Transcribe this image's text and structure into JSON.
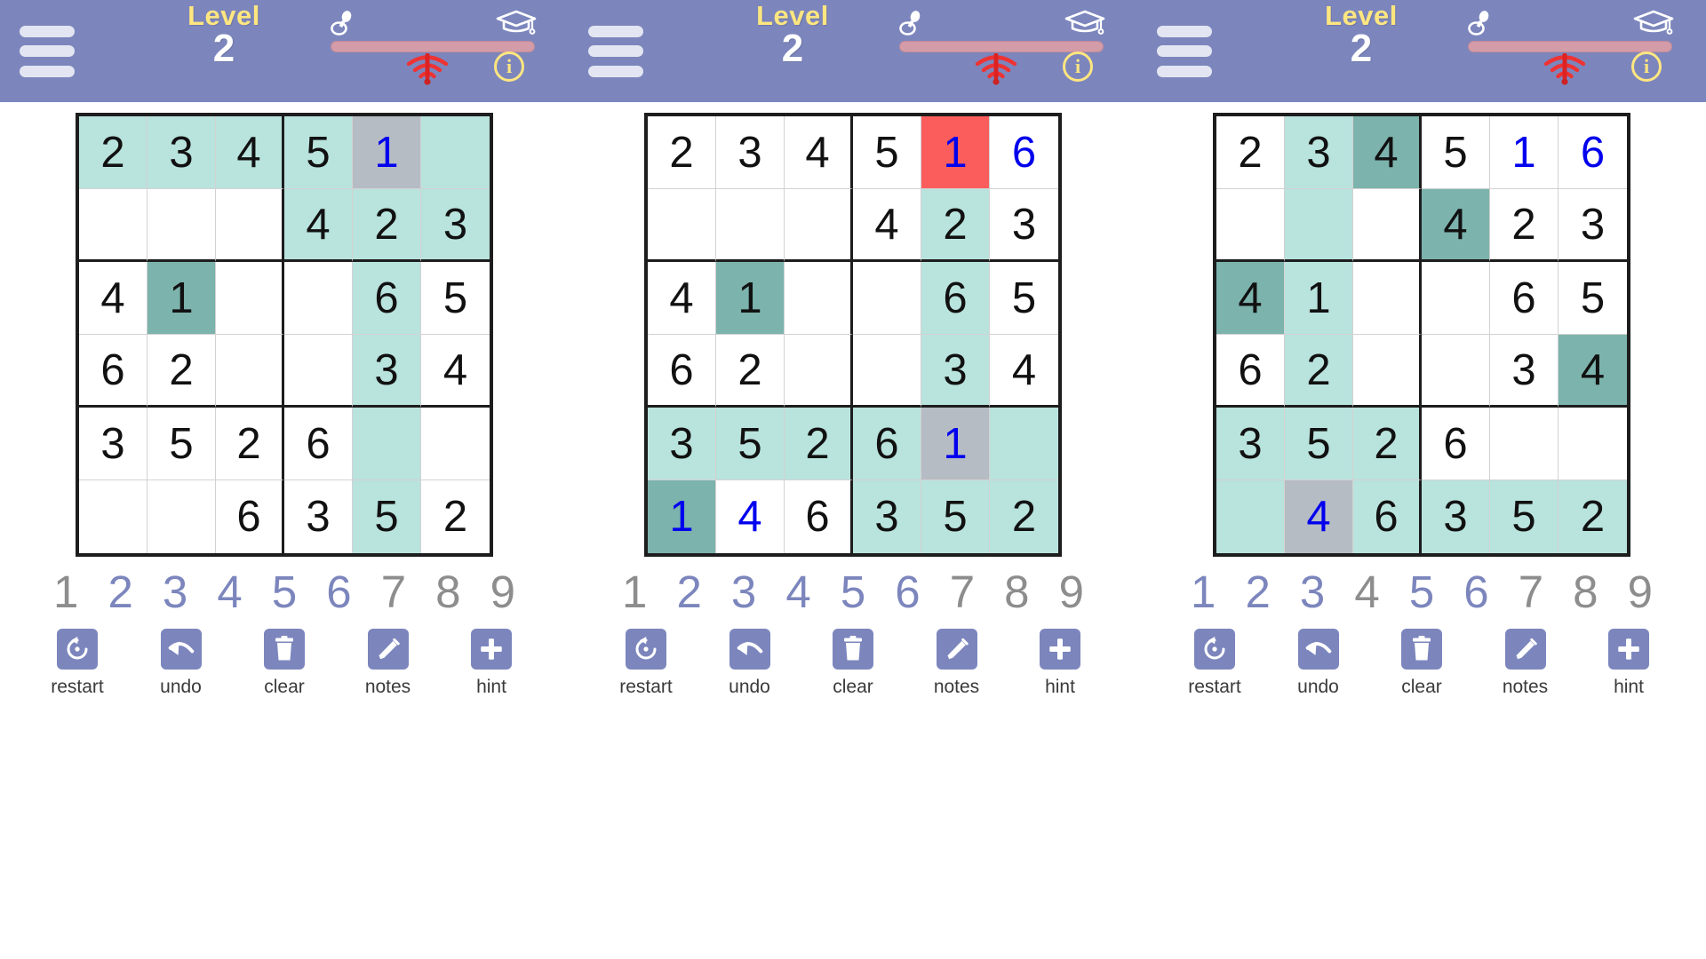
{
  "app": {
    "name": "sudoku-6x6",
    "panel_count": 3
  },
  "header": {
    "menu_icon": "hamburger-menu-icon",
    "level_word": "Level",
    "level_number": "2",
    "difficulty": {
      "easy_icon": "pacifier-icon",
      "hard_icon": "graduation-cap-icon",
      "signal_icon": "wifi-off-icon",
      "info_icon": "info-icon",
      "info_label": "i",
      "slider_value": 0,
      "track_color": "#d49ba8"
    },
    "bg_color": "#7c86bd",
    "level_word_color": "#ffe680",
    "level_number_color": "#ffffff"
  },
  "colors": {
    "highlight_light": "#b9e3dd",
    "highlight_dark": "#7cb3ad",
    "selected_gray": "#b6bcc4",
    "error_red": "#fb5d5d",
    "user_number_blue": "#0000ee",
    "given_number_black": "#111111",
    "accent": "#7c86bd"
  },
  "grid_layout": {
    "size": 6,
    "box_cols": 3,
    "box_rows": 2
  },
  "panels": [
    {
      "id": "panel-1",
      "cells": [
        [
          {
            "v": "2",
            "s": "light"
          },
          {
            "v": "3",
            "s": "light"
          },
          {
            "v": "4",
            "s": "light"
          },
          {
            "v": "5",
            "s": "light"
          },
          {
            "v": "1",
            "s": "selected",
            "c": "blue"
          },
          {
            "v": "",
            "s": "light"
          }
        ],
        [
          {
            "v": "",
            "s": "none"
          },
          {
            "v": "",
            "s": "none"
          },
          {
            "v": "",
            "s": "none"
          },
          {
            "v": "4",
            "s": "light"
          },
          {
            "v": "2",
            "s": "light"
          },
          {
            "v": "3",
            "s": "light"
          }
        ],
        [
          {
            "v": "4",
            "s": "none"
          },
          {
            "v": "1",
            "s": "dark"
          },
          {
            "v": "",
            "s": "none"
          },
          {
            "v": "",
            "s": "none"
          },
          {
            "v": "6",
            "s": "light"
          },
          {
            "v": "5",
            "s": "none"
          }
        ],
        [
          {
            "v": "6",
            "s": "none"
          },
          {
            "v": "2",
            "s": "none"
          },
          {
            "v": "",
            "s": "none"
          },
          {
            "v": "",
            "s": "none"
          },
          {
            "v": "3",
            "s": "light"
          },
          {
            "v": "4",
            "s": "none"
          }
        ],
        [
          {
            "v": "3",
            "s": "none"
          },
          {
            "v": "5",
            "s": "none"
          },
          {
            "v": "2",
            "s": "none"
          },
          {
            "v": "6",
            "s": "none"
          },
          {
            "v": "",
            "s": "light"
          },
          {
            "v": "",
            "s": "none"
          }
        ],
        [
          {
            "v": "",
            "s": "none"
          },
          {
            "v": "",
            "s": "none"
          },
          {
            "v": "6",
            "s": "none"
          },
          {
            "v": "3",
            "s": "none"
          },
          {
            "v": "5",
            "s": "light"
          },
          {
            "v": "2",
            "s": "none"
          }
        ]
      ],
      "numpad": [
        {
          "n": "1",
          "state": "done"
        },
        {
          "n": "2",
          "state": "active"
        },
        {
          "n": "3",
          "state": "active"
        },
        {
          "n": "4",
          "state": "active"
        },
        {
          "n": "5",
          "state": "active"
        },
        {
          "n": "6",
          "state": "active"
        },
        {
          "n": "7",
          "state": "done"
        },
        {
          "n": "8",
          "state": "done"
        },
        {
          "n": "9",
          "state": "done"
        }
      ]
    },
    {
      "id": "panel-2",
      "cells": [
        [
          {
            "v": "2",
            "s": "none"
          },
          {
            "v": "3",
            "s": "none"
          },
          {
            "v": "4",
            "s": "none"
          },
          {
            "v": "5",
            "s": "none"
          },
          {
            "v": "1",
            "s": "error",
            "c": "blue"
          },
          {
            "v": "6",
            "s": "none",
            "c": "blue"
          }
        ],
        [
          {
            "v": "",
            "s": "none"
          },
          {
            "v": "",
            "s": "none"
          },
          {
            "v": "",
            "s": "none"
          },
          {
            "v": "4",
            "s": "none"
          },
          {
            "v": "2",
            "s": "light"
          },
          {
            "v": "3",
            "s": "none"
          }
        ],
        [
          {
            "v": "4",
            "s": "none"
          },
          {
            "v": "1",
            "s": "dark"
          },
          {
            "v": "",
            "s": "none"
          },
          {
            "v": "",
            "s": "none"
          },
          {
            "v": "6",
            "s": "light"
          },
          {
            "v": "5",
            "s": "none"
          }
        ],
        [
          {
            "v": "6",
            "s": "none"
          },
          {
            "v": "2",
            "s": "none"
          },
          {
            "v": "",
            "s": "none"
          },
          {
            "v": "",
            "s": "none"
          },
          {
            "v": "3",
            "s": "light"
          },
          {
            "v": "4",
            "s": "none"
          }
        ],
        [
          {
            "v": "3",
            "s": "light"
          },
          {
            "v": "5",
            "s": "light"
          },
          {
            "v": "2",
            "s": "light"
          },
          {
            "v": "6",
            "s": "light"
          },
          {
            "v": "1",
            "s": "selected",
            "c": "blue"
          },
          {
            "v": "",
            "s": "light"
          }
        ],
        [
          {
            "v": "1",
            "s": "dark",
            "c": "blue"
          },
          {
            "v": "4",
            "s": "none",
            "c": "blue"
          },
          {
            "v": "6",
            "s": "none"
          },
          {
            "v": "3",
            "s": "light"
          },
          {
            "v": "5",
            "s": "light"
          },
          {
            "v": "2",
            "s": "light"
          }
        ]
      ],
      "numpad": [
        {
          "n": "1",
          "state": "done"
        },
        {
          "n": "2",
          "state": "active"
        },
        {
          "n": "3",
          "state": "active"
        },
        {
          "n": "4",
          "state": "active"
        },
        {
          "n": "5",
          "state": "active"
        },
        {
          "n": "6",
          "state": "active"
        },
        {
          "n": "7",
          "state": "done"
        },
        {
          "n": "8",
          "state": "done"
        },
        {
          "n": "9",
          "state": "done"
        }
      ]
    },
    {
      "id": "panel-3",
      "cells": [
        [
          {
            "v": "2",
            "s": "none"
          },
          {
            "v": "3",
            "s": "light"
          },
          {
            "v": "4",
            "s": "dark"
          },
          {
            "v": "5",
            "s": "none"
          },
          {
            "v": "1",
            "s": "none",
            "c": "blue"
          },
          {
            "v": "6",
            "s": "none",
            "c": "blue"
          }
        ],
        [
          {
            "v": "",
            "s": "none"
          },
          {
            "v": "",
            "s": "light"
          },
          {
            "v": "",
            "s": "none"
          },
          {
            "v": "4",
            "s": "dark"
          },
          {
            "v": "2",
            "s": "none"
          },
          {
            "v": "3",
            "s": "none"
          }
        ],
        [
          {
            "v": "4",
            "s": "dark"
          },
          {
            "v": "1",
            "s": "light"
          },
          {
            "v": "",
            "s": "none"
          },
          {
            "v": "",
            "s": "none"
          },
          {
            "v": "6",
            "s": "none"
          },
          {
            "v": "5",
            "s": "none"
          }
        ],
        [
          {
            "v": "6",
            "s": "none"
          },
          {
            "v": "2",
            "s": "light"
          },
          {
            "v": "",
            "s": "none"
          },
          {
            "v": "",
            "s": "none"
          },
          {
            "v": "3",
            "s": "none"
          },
          {
            "v": "4",
            "s": "dark"
          }
        ],
        [
          {
            "v": "3",
            "s": "light"
          },
          {
            "v": "5",
            "s": "light"
          },
          {
            "v": "2",
            "s": "light"
          },
          {
            "v": "6",
            "s": "none"
          },
          {
            "v": "",
            "s": "none"
          },
          {
            "v": "",
            "s": "none"
          }
        ],
        [
          {
            "v": "",
            "s": "light"
          },
          {
            "v": "4",
            "s": "selected",
            "c": "blue"
          },
          {
            "v": "6",
            "s": "light"
          },
          {
            "v": "3",
            "s": "light"
          },
          {
            "v": "5",
            "s": "light"
          },
          {
            "v": "2",
            "s": "light"
          }
        ]
      ],
      "numpad": [
        {
          "n": "1",
          "state": "active"
        },
        {
          "n": "2",
          "state": "active"
        },
        {
          "n": "3",
          "state": "active"
        },
        {
          "n": "4",
          "state": "done"
        },
        {
          "n": "5",
          "state": "active"
        },
        {
          "n": "6",
          "state": "active"
        },
        {
          "n": "7",
          "state": "done"
        },
        {
          "n": "8",
          "state": "done"
        },
        {
          "n": "9",
          "state": "done"
        }
      ]
    }
  ],
  "toolbar": [
    {
      "icon": "restart-icon",
      "label": "restart"
    },
    {
      "icon": "undo-icon",
      "label": "undo"
    },
    {
      "icon": "trash-icon",
      "label": "clear"
    },
    {
      "icon": "pencil-icon",
      "label": "notes"
    },
    {
      "icon": "plus-icon",
      "label": "hint"
    }
  ]
}
